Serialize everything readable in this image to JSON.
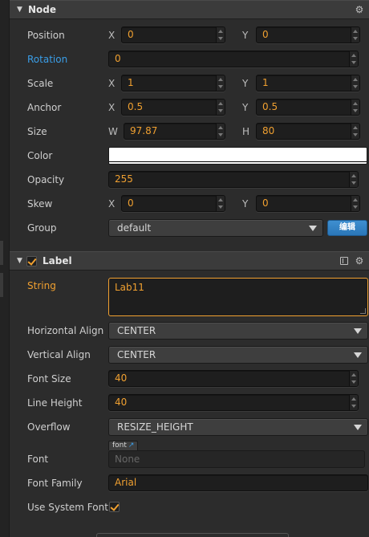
{
  "node_section": {
    "title": "Node",
    "position": {
      "label": "Position",
      "x_axis": "X",
      "x": "0",
      "y_axis": "Y",
      "y": "0"
    },
    "rotation": {
      "label": "Rotation",
      "value": "0"
    },
    "scale": {
      "label": "Scale",
      "x_axis": "X",
      "x": "1",
      "y_axis": "Y",
      "y": "1"
    },
    "anchor": {
      "label": "Anchor",
      "x_axis": "X",
      "x": "0.5",
      "y_axis": "Y",
      "y": "0.5"
    },
    "size": {
      "label": "Size",
      "w_axis": "W",
      "w": "97.87",
      "h_axis": "H",
      "h": "80"
    },
    "color": {
      "label": "Color",
      "value": "#ffffff"
    },
    "opacity": {
      "label": "Opacity",
      "value": "255"
    },
    "skew": {
      "label": "Skew",
      "x_axis": "X",
      "x": "0",
      "y_axis": "Y",
      "y": "0"
    },
    "group": {
      "label": "Group",
      "value": "default",
      "edit_button": "编辑"
    }
  },
  "label_section": {
    "title": "Label",
    "enabled": true,
    "string": {
      "label": "String",
      "value": "Lab11"
    },
    "horizontal_align": {
      "label": "Horizontal Align",
      "value": "CENTER"
    },
    "vertical_align": {
      "label": "Vertical Align",
      "value": "CENTER"
    },
    "font_size": {
      "label": "Font Size",
      "value": "40"
    },
    "line_height": {
      "label": "Line Height",
      "value": "40"
    },
    "overflow": {
      "label": "Overflow",
      "value": "RESIZE_HEIGHT"
    },
    "font": {
      "label": "Font",
      "tag": "font",
      "value": "None"
    },
    "font_family": {
      "label": "Font Family",
      "value": "Arial"
    },
    "use_system_font": {
      "label": "Use System Font",
      "checked": true
    }
  },
  "colors": {
    "accent_orange": "#f0a030",
    "accent_blue": "#3a9ee8",
    "panel_bg": "#2c2c2c",
    "header_bg": "#3b3b3b",
    "field_bg": "#1e1e1e"
  },
  "icons": [
    "collapse-caret-icon",
    "gear-icon",
    "book-icon",
    "checkbox-icon",
    "spinner-icon",
    "dropdown-arrow-icon",
    "external-link-icon"
  ]
}
